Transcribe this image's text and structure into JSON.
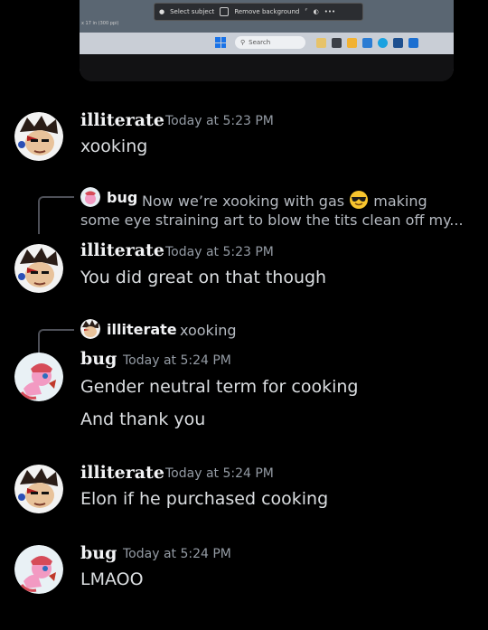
{
  "photo": {
    "toolbar": {
      "select_subject": "Select subject",
      "remove_background": "Remove background",
      "more": "•••"
    },
    "status_text": "x 17 in (300 ppi)",
    "taskbar": {
      "search_placeholder": "Search"
    }
  },
  "messages": [
    {
      "user": "illiterate",
      "time": "Today at 5:23 PM",
      "lines": [
        "xooking"
      ]
    },
    {
      "reply": {
        "user": "bug",
        "text_before_emoji": "Now we’re xooking with gas",
        "emoji_name": "smiling-face-with-sunglasses",
        "text_after_emoji": "making",
        "text_line2": "some eye straining art to blow the tits clean off my..."
      },
      "user": "illiterate",
      "time": "Today at 5:23 PM",
      "lines": [
        "You did great on that though"
      ]
    },
    {
      "reply": {
        "user": "illiterate",
        "text": "xooking"
      },
      "user": "bug",
      "time": "Today at 5:24 PM",
      "lines": [
        "Gender neutral term for cooking",
        "And thank you"
      ]
    },
    {
      "user": "illiterate",
      "time": "Today at 5:24 PM",
      "lines": [
        "Elon if he purchased cooking"
      ]
    },
    {
      "user": "bug",
      "time": "Today at 5:24 PM",
      "lines": [
        "LMAOO"
      ]
    }
  ]
}
